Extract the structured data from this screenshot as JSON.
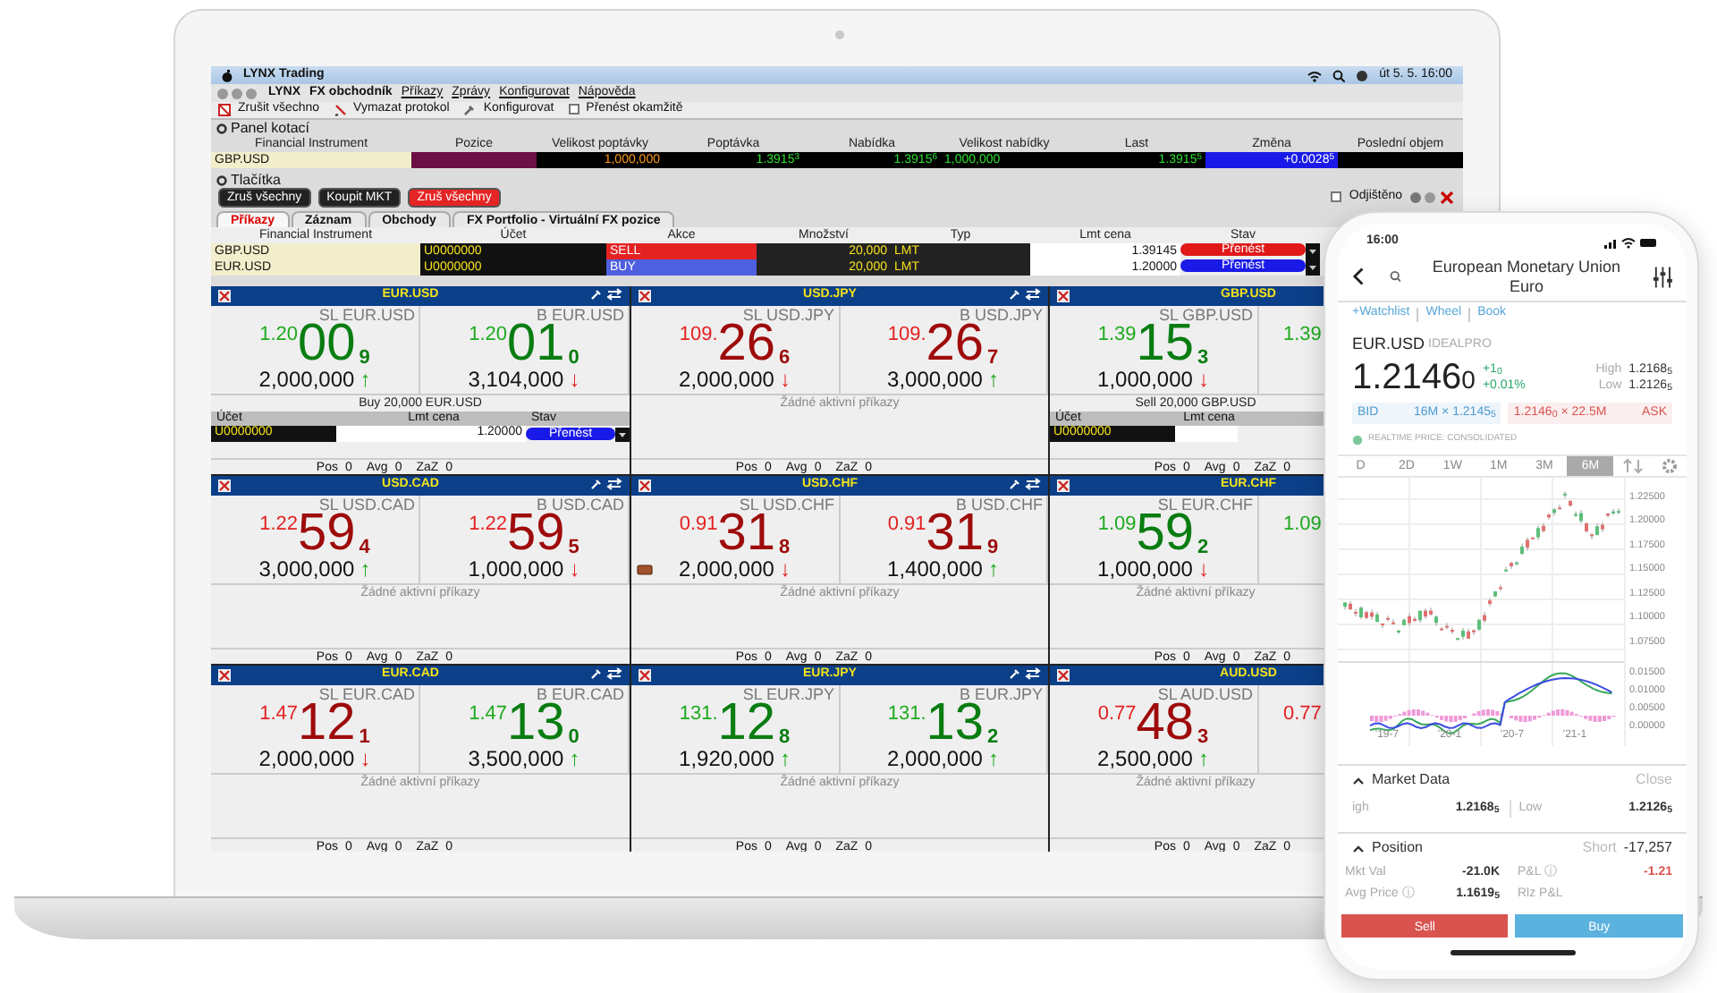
{
  "laptop": {
    "menu_bar": {
      "app": "LYNX Trading",
      "clock": "út 5. 5. 16:00"
    },
    "app_menu": [
      {
        "label": "LYNX",
        "bold": true
      },
      {
        "label": "FX obchodník",
        "bold": true
      },
      {
        "label": "Příkazy",
        "bold": false
      },
      {
        "label": "Zprávy",
        "bold": false
      },
      {
        "label": "Konfigurovat",
        "bold": false
      },
      {
        "label": "Nápověda",
        "bold": false
      }
    ],
    "toolbar": [
      {
        "kind": "button",
        "label": "Zrušit všechno"
      },
      {
        "kind": "button",
        "label": "Vymazat protokol"
      },
      {
        "kind": "button",
        "label": "Konfigurovat"
      },
      {
        "kind": "checkbox",
        "label": "Přenést okamžitě",
        "checked": false
      }
    ],
    "quote_panel": {
      "title": "Panel kotací",
      "columns": [
        "Financial Instrument",
        "Pozice",
        "Velikost poptávky",
        "Poptávka",
        "Nabídka",
        "Velikost nabídky",
        "Last",
        "Změna",
        "Poslední objem"
      ],
      "row": {
        "instrument": "GBP.USD",
        "bid_size": "1,000,000",
        "bid": "1.3915$^{3}$",
        "ask": "1.3915$^{6}$",
        "ask_size": "1,000,000",
        "last": "1.3915$^{5}$",
        "change": "+0.0028$^{5}$"
      }
    },
    "buttons_panel": {
      "title": "Tlačítka",
      "buttons": [
        {
          "label": "Zruš všechny",
          "color": "#222222"
        },
        {
          "label": "Koupit MKT",
          "color": "#222222"
        },
        {
          "label": "Zruš všechny",
          "color": "#e52424"
        }
      ],
      "lock": {
        "label": "Odjištěno",
        "checked": false
      }
    },
    "orders": {
      "tabs": [
        {
          "label": "Příkazy",
          "selected": true
        },
        {
          "label": "Záznam",
          "selected": false
        },
        {
          "label": "Obchody",
          "selected": false
        },
        {
          "label": "FX Portfolio - Virtuální  FX pozice",
          "selected": false
        }
      ],
      "columns": [
        "Financial Instrument",
        "Účet",
        "Akce",
        "Množství",
        "Typ",
        "Lmt cena",
        "Stav"
      ],
      "rows": [
        {
          "instrument": "GBP.USD",
          "account": "U0000000",
          "action": "SELL",
          "kind": "sell",
          "quantity": "20,000",
          "type": "LMT",
          "limit": "1.39145",
          "status": "Přenést"
        },
        {
          "instrument": "EUR.USD",
          "account": "U0000000",
          "action": "BUY",
          "kind": "buy",
          "quantity": "20,000",
          "type": "LMT",
          "limit": "1.20000",
          "status": "Přenést"
        }
      ]
    },
    "tiles": [
      {
        "symbol": "EUR.USD",
        "header_tools": true,
        "sides": [
          {
            "label": "SL EUR.USD",
            "prefix": "1.20",
            "big": "00",
            "last": "9",
            "rising": true,
            "qty": "2,000,000",
            "arrow": "↑",
            "arrow_rising": true,
            "icon": false
          },
          {
            "label": "B EUR.USD",
            "prefix": "1.20",
            "big": "01",
            "last": "0",
            "rising": true,
            "qty": "3,104,000",
            "arrow": "↓",
            "arrow_rising": false,
            "icon": false
          }
        ],
        "order": {
          "title": "Buy 20,000 EUR.USD",
          "columns": [
            "Účet",
            "Lmt cena",
            "Stav"
          ],
          "account": "U0000000",
          "limit": "1.20000",
          "status": "Přenést"
        },
        "stats": [
          {
            "label": "Pos",
            "value": "0"
          },
          {
            "label": "Avg",
            "value": "0"
          },
          {
            "label": "ZaZ",
            "value": "0"
          }
        ]
      },
      {
        "symbol": "USD.JPY",
        "header_tools": true,
        "sides": [
          {
            "label": "SL USD.JPY",
            "prefix": "109.",
            "big": "26",
            "last": "6",
            "rising": false,
            "qty": "2,000,000",
            "arrow": "↓",
            "arrow_rising": false,
            "icon": false
          },
          {
            "label": "B USD.JPY",
            "prefix": "109.",
            "big": "26",
            "last": "7",
            "rising": false,
            "qty": "3,000,000",
            "arrow": "↑",
            "arrow_rising": true,
            "icon": false
          }
        ],
        "note": "Žádné aktivní příkazy",
        "stats": [
          {
            "label": "Pos",
            "value": "0"
          },
          {
            "label": "Avg",
            "value": "0"
          },
          {
            "label": "ZaZ",
            "value": "0"
          }
        ]
      },
      {
        "symbol": "GBP.USD",
        "header_tools": false,
        "sides": [
          {
            "label": "SL GBP.USD",
            "prefix": "1.39",
            "big": "15",
            "last": "3",
            "rising": true,
            "qty": "1,000,000",
            "arrow": "↓",
            "arrow_rising": false,
            "icon": false
          },
          {
            "prefix": "1.39",
            "rising": true
          }
        ],
        "order": {
          "title": "Sell 20,000 GBP.USD",
          "columns": [
            "Účet",
            "Lmt cena"
          ],
          "account": "U0000000"
        },
        "stats": [
          {
            "label": "Pos",
            "value": "0"
          },
          {
            "label": "Avg",
            "value": "0"
          },
          {
            "label": "ZaZ",
            "value": "0"
          }
        ]
      },
      {
        "symbol": "USD.CAD",
        "header_tools": true,
        "sides": [
          {
            "label": "SL USD.CAD",
            "prefix": "1.22",
            "big": "59",
            "last": "4",
            "rising": false,
            "qty": "3,000,000",
            "arrow": "↑",
            "arrow_rising": true,
            "icon": false
          },
          {
            "label": "B USD.CAD",
            "prefix": "1.22",
            "big": "59",
            "last": "5",
            "rising": false,
            "qty": "1,000,000",
            "arrow": "↓",
            "arrow_rising": false,
            "icon": false
          }
        ],
        "note": "Žádné aktivní příkazy",
        "stats": [
          {
            "label": "Pos",
            "value": "0"
          },
          {
            "label": "Avg",
            "value": "0"
          },
          {
            "label": "ZaZ",
            "value": "0"
          }
        ]
      },
      {
        "symbol": "USD.CHF",
        "header_tools": true,
        "sides": [
          {
            "label": "SL USD.CHF",
            "prefix": "0.91",
            "big": "31",
            "last": "8",
            "rising": false,
            "qty": "2,000,000",
            "arrow": "↓",
            "arrow_rising": false,
            "icon": true
          },
          {
            "label": "B USD.CHF",
            "prefix": "0.91",
            "big": "31",
            "last": "9",
            "rising": false,
            "qty": "1,400,000",
            "arrow": "↑",
            "arrow_rising": true,
            "icon": false
          }
        ],
        "note": "Žádné aktivní příkazy",
        "stats": [
          {
            "label": "Pos",
            "value": "0"
          },
          {
            "label": "Avg",
            "value": "0"
          },
          {
            "label": "ZaZ",
            "value": "0"
          }
        ]
      },
      {
        "symbol": "EUR.CHF",
        "header_tools": false,
        "sides": [
          {
            "label": "SL EUR.CHF",
            "prefix": "1.09",
            "big": "59",
            "last": "2",
            "rising": true,
            "qty": "1,000,000",
            "arrow": "↓",
            "arrow_rising": false,
            "icon": false
          },
          {
            "prefix": "1.09",
            "rising": true
          }
        ],
        "note": "Žádné aktivní příkazy",
        "stats": [
          {
            "label": "Pos",
            "value": "0"
          },
          {
            "label": "Avg",
            "value": "0"
          },
          {
            "label": "ZaZ",
            "value": "0"
          }
        ]
      },
      {
        "symbol": "EUR.CAD",
        "header_tools": true,
        "sides": [
          {
            "label": "SL EUR.CAD",
            "prefix": "1.47",
            "big": "12",
            "last": "1",
            "rising": false,
            "qty": "2,000,000",
            "arrow": "↓",
            "arrow_rising": false,
            "icon": false
          },
          {
            "label": "B EUR.CAD",
            "prefix": "1.47",
            "big": "13",
            "last": "0",
            "rising": true,
            "qty": "3,500,000",
            "arrow": "↑",
            "arrow_rising": true,
            "icon": false
          }
        ],
        "note": "Žádné aktivní příkazy",
        "stats": [
          {
            "label": "Pos",
            "value": "0"
          },
          {
            "label": "Avg",
            "value": "0"
          },
          {
            "label": "ZaZ",
            "value": "0"
          }
        ]
      },
      {
        "symbol": "EUR.JPY",
        "header_tools": true,
        "sides": [
          {
            "label": "SL EUR.JPY",
            "prefix": "131.",
            "big": "12",
            "last": "8",
            "rising": true,
            "qty": "1,920,000",
            "arrow": "↑",
            "arrow_rising": true,
            "icon": false
          },
          {
            "label": "B EUR.JPY",
            "prefix": "131.",
            "big": "13",
            "last": "2",
            "rising": true,
            "qty": "2,000,000",
            "arrow": "↑",
            "arrow_rising": true,
            "icon": false
          }
        ],
        "note": "Žádné aktivní příkazy",
        "stats": [
          {
            "label": "Pos",
            "value": "0"
          },
          {
            "label": "Avg",
            "value": "0"
          },
          {
            "label": "ZaZ",
            "value": "0"
          }
        ]
      },
      {
        "symbol": "AUD.USD",
        "header_tools": false,
        "sides": [
          {
            "label": "SL AUD.USD",
            "prefix": "0.77",
            "big": "48",
            "last": "3",
            "rising": false,
            "qty": "2,500,000",
            "arrow": "↑",
            "arrow_rising": true,
            "icon": false
          },
          {
            "prefix": "0.77",
            "rising": false
          }
        ],
        "note": "Žádné aktivní příkazy",
        "stats": [
          {
            "label": "Pos",
            "value": "0"
          },
          {
            "label": "Avg",
            "value": "0"
          },
          {
            "label": "ZaZ",
            "value": "0"
          }
        ]
      }
    ]
  },
  "phone": {
    "clock": "16:00",
    "title": "European Monetary Union Euro",
    "links": [
      "+Watchlist",
      "Wheel",
      "Book"
    ],
    "symbol": "EUR.USD",
    "exchange": "IDEALPRO",
    "price": "1.2146",
    "price_last": "0",
    "change": "+1$_{0}$",
    "change_pct": "+0.01%",
    "stats": [
      {
        "label": "High",
        "value": "1.2168$_{5}$"
      },
      {
        "label": "Low",
        "value": "1.2126$_{5}$"
      }
    ],
    "bid": {
      "label": "BID",
      "text": "16M × 1.2145$_{5}$"
    },
    "ask": {
      "text": "1.2146$_{0}$ × 22.5M",
      "label": "ASK"
    },
    "realtime": "REALTIME PRICE: CONSOLIDATED",
    "ranges": [
      {
        "label": "D",
        "selected": false
      },
      {
        "label": "2D",
        "selected": false
      },
      {
        "label": "1W",
        "selected": false
      },
      {
        "label": "1M",
        "selected": false
      },
      {
        "label": "3M",
        "selected": false
      },
      {
        "label": "6M",
        "selected": true
      }
    ],
    "price_ticks": [
      "1.22500",
      "1.20000",
      "1.17500",
      "1.15000",
      "1.12500",
      "1.10000",
      "1.07500"
    ],
    "macd_ticks": [
      "0.01500",
      "0.01000",
      "0.00500",
      "0.00000"
    ],
    "x_ticks": [
      "'19-7",
      "'20-1",
      "'20-7",
      "'21-1"
    ],
    "market_data": {
      "title": "Market Data",
      "action": "Close",
      "items": [
        {
          "label": "igh",
          "value": "1.2168$_{5}$"
        },
        {
          "label": "Low",
          "value": "1.2126$_{5}$"
        }
      ]
    },
    "position": {
      "title": "Position",
      "side": "Short",
      "amount": "-17,257",
      "items": [
        {
          "label": "Mkt Val",
          "value": "-21.0K",
          "negative": false
        },
        {
          "label": "P&L ⓘ",
          "value": "-1.21",
          "negative": true
        },
        {
          "label": "Avg Price ⓘ",
          "value": "1.1619$_{5}$",
          "negative": false
        },
        {
          "label": "Rlz P&L"
        }
      ]
    },
    "actions": [
      {
        "label": "Sell",
        "kind": "sell"
      },
      {
        "label": "Buy",
        "kind": "buy"
      }
    ]
  }
}
